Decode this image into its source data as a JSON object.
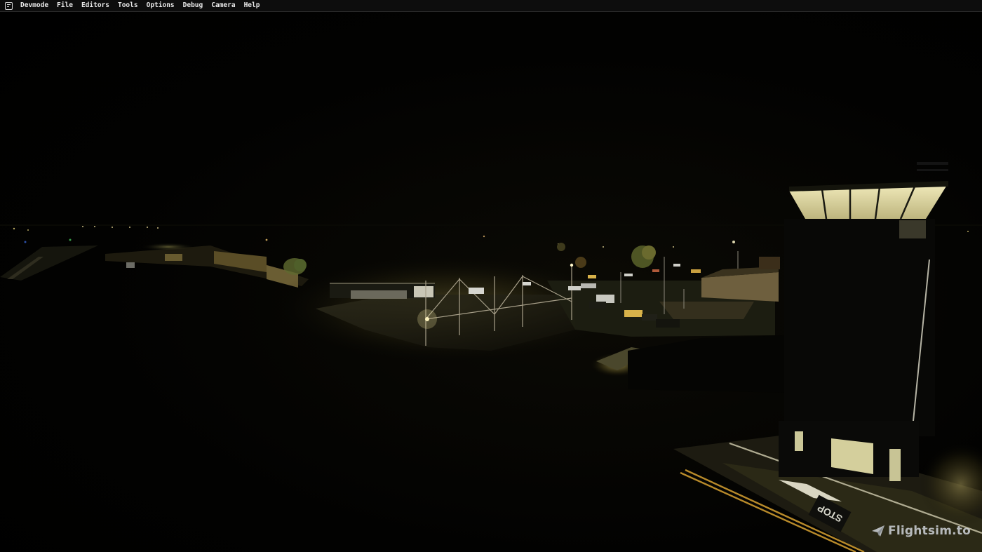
{
  "app": {
    "icon": "devmode-app-icon"
  },
  "menubar": {
    "items": [
      {
        "label": "Devmode"
      },
      {
        "label": "File"
      },
      {
        "label": "Editors"
      },
      {
        "label": "Tools"
      },
      {
        "label": "Options"
      },
      {
        "label": "Debug"
      },
      {
        "label": "Camera"
      },
      {
        "label": "Help"
      }
    ]
  },
  "scene": {
    "ground_marking": "STOP"
  },
  "watermark": {
    "icon": "paper-plane-icon",
    "text": "Flightsim.to"
  },
  "colors": {
    "menubar_bg": "#0d0d0d",
    "menu_text": "#e8e8e8",
    "sodium_light": "#f2e6a0",
    "tower_glass": "#e8e2b0",
    "watermark": "#cfd3d8"
  }
}
